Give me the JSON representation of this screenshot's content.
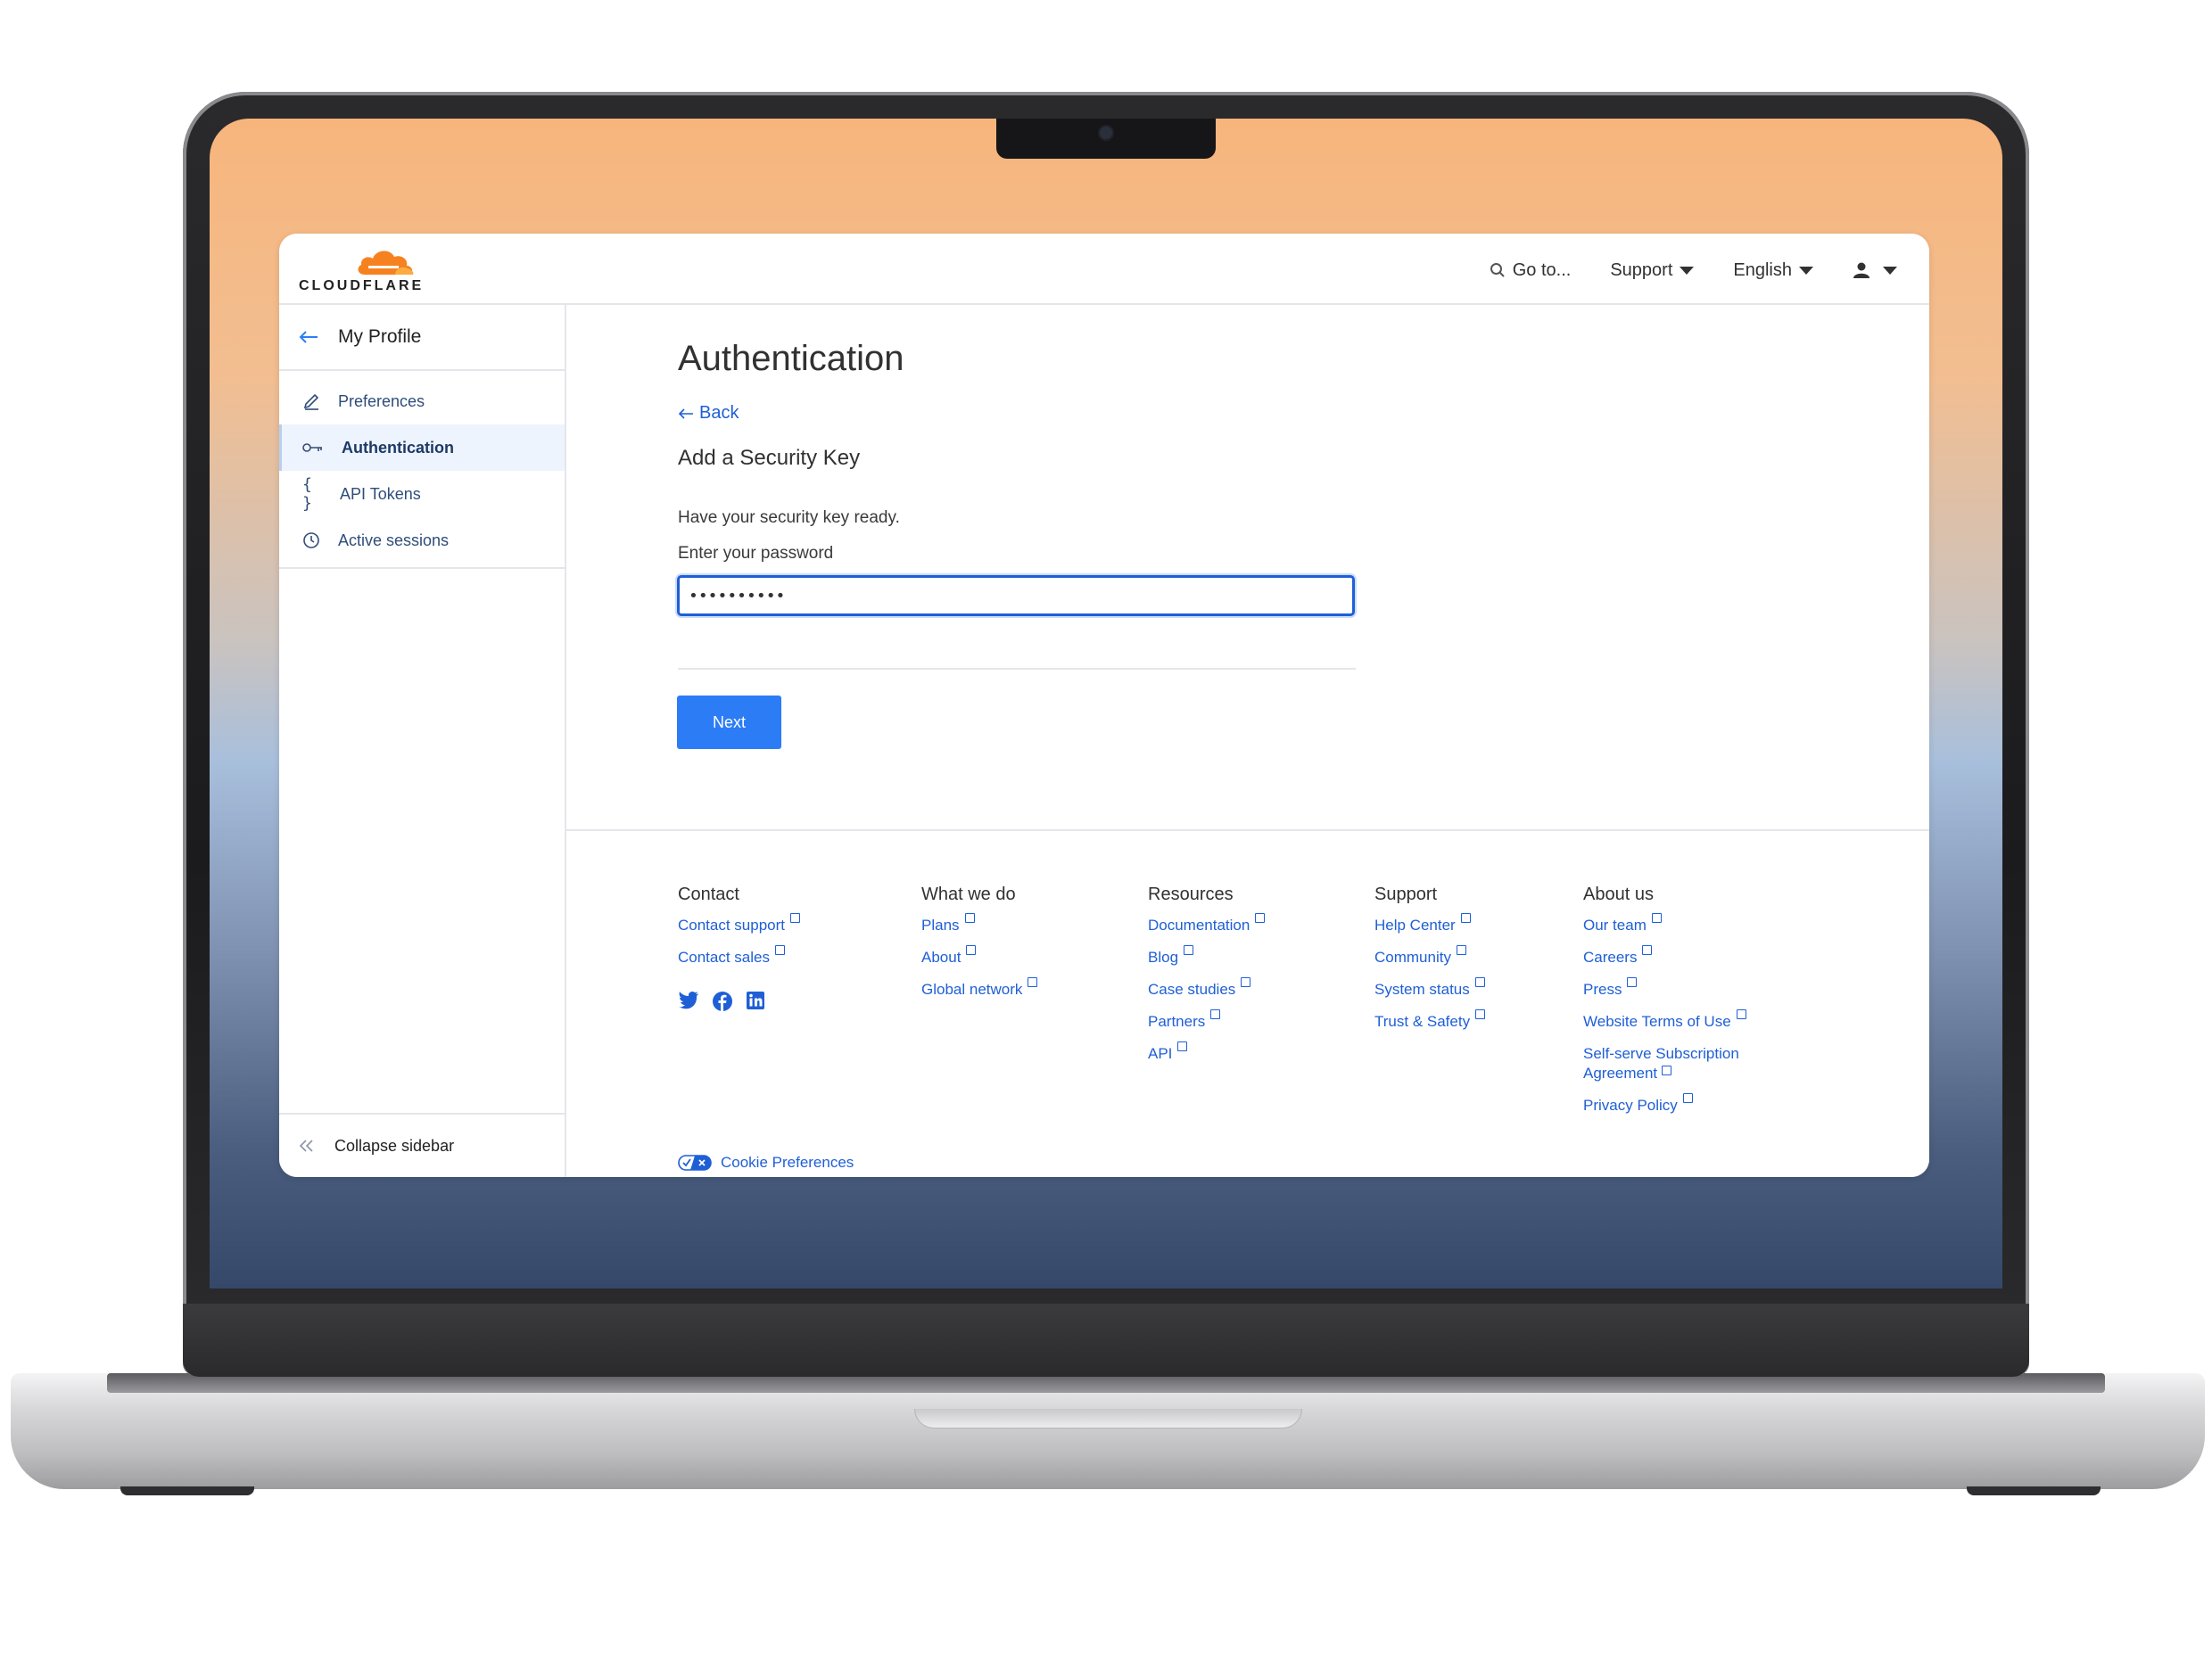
{
  "app": {
    "brand": "CLOUDFLARE",
    "accent_color": "#2c7cf6",
    "link_color": "#1f5fd6"
  },
  "topbar": {
    "goto_label": "Go to...",
    "support_label": "Support",
    "language_label": "English"
  },
  "sidebar": {
    "back_title": "My Profile",
    "items": [
      {
        "label": "Preferences",
        "icon": "pencil-icon"
      },
      {
        "label": "Authentication",
        "icon": "key-icon",
        "active": true
      },
      {
        "label": "API Tokens",
        "icon": "braces-icon"
      },
      {
        "label": "Active sessions",
        "icon": "clock-icon"
      }
    ],
    "collapse_label": "Collapse sidebar"
  },
  "main": {
    "title": "Authentication",
    "back_label": "Back",
    "subtitle": "Add a Security Key",
    "instruction": "Have your security key ready.",
    "password_label": "Enter your password",
    "password_value": "••••••••••",
    "next_label": "Next"
  },
  "footer": {
    "columns": [
      {
        "heading": "Contact",
        "links": [
          "Contact support",
          "Contact sales"
        ]
      },
      {
        "heading": "What we do",
        "links": [
          "Plans",
          "About",
          "Global network"
        ]
      },
      {
        "heading": "Resources",
        "links": [
          "Documentation",
          "Blog",
          "Case studies",
          "Partners",
          "API"
        ]
      },
      {
        "heading": "Support",
        "links": [
          "Help Center",
          "Community",
          "System status",
          "Trust & Safety"
        ]
      },
      {
        "heading": "About us",
        "links": [
          "Our team",
          "Careers",
          "Press",
          "Website Terms of Use",
          "Self-serve Subscription Agreement",
          "Privacy Policy"
        ]
      }
    ],
    "social_icons": [
      "twitter-icon",
      "facebook-icon",
      "linkedin-icon"
    ],
    "cookie_label": "Cookie Preferences"
  }
}
